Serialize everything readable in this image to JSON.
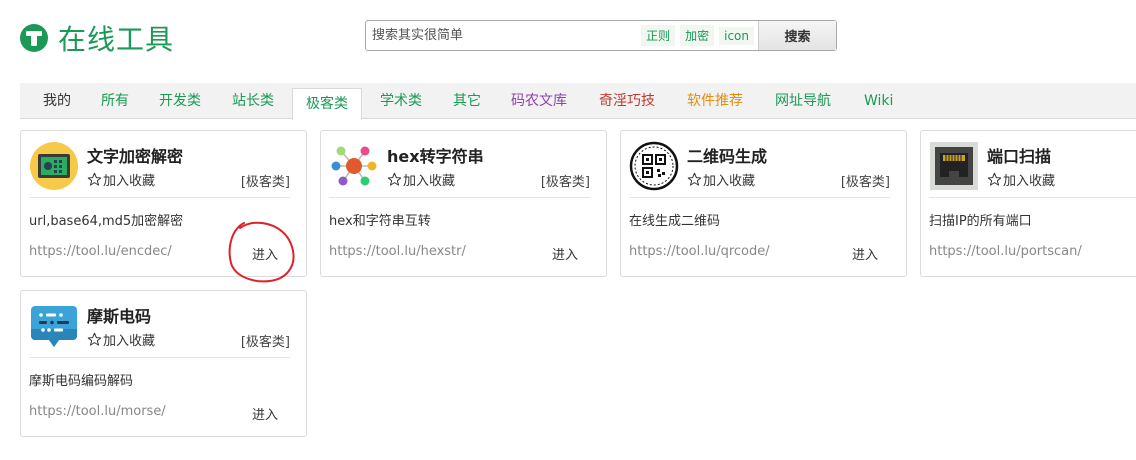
{
  "header": {
    "logo_text": "在线工具",
    "search_placeholder": "搜索其实很简单",
    "search_tags": [
      "正则",
      "加密",
      "icon"
    ],
    "search_button": "搜索"
  },
  "tabs": [
    {
      "label": "我的",
      "color": "#333333"
    },
    {
      "label": "所有",
      "color": "#1a9a55"
    },
    {
      "label": "开发类",
      "color": "#1a9a55"
    },
    {
      "label": "站长类",
      "color": "#1a9a55"
    },
    {
      "label": "极客类",
      "color": "#1a9a55",
      "active": true
    },
    {
      "label": "学术类",
      "color": "#1a9a55"
    },
    {
      "label": "其它",
      "color": "#1a9a55"
    },
    {
      "label": "码农文库",
      "color": "#8e44ad"
    },
    {
      "label": "奇淫巧技",
      "color": "#c0392b"
    },
    {
      "label": "软件推荐",
      "color": "#e08e0b"
    },
    {
      "label": "网址导航",
      "color": "#1a9a55"
    },
    {
      "label": "Wiki",
      "color": "#1a9a55"
    }
  ],
  "cards": [
    {
      "title": "文字加密解密",
      "fav": "加入收藏",
      "category": "[极客类]",
      "desc": "url,base64,md5加密解密",
      "url": "https://tool.lu/encdec/",
      "enter": "进入",
      "icon": "safe-icon"
    },
    {
      "title": "hex转字符串",
      "fav": "加入收藏",
      "category": "[极客类]",
      "desc": "hex和字符串互转",
      "url": "https://tool.lu/hexstr/",
      "enter": "进入",
      "icon": "network-icon"
    },
    {
      "title": "二维码生成",
      "fav": "加入收藏",
      "category": "[极客类]",
      "desc": "在线生成二维码",
      "url": "https://tool.lu/qrcode/",
      "enter": "进入",
      "icon": "qrcode-icon"
    },
    {
      "title": "端口扫描",
      "fav": "加入收藏",
      "category": "",
      "desc": "扫描IP的所有端口",
      "url": "https://tool.lu/portscan/",
      "enter": "",
      "icon": "ethernet-port-icon"
    },
    {
      "title": "摩斯电码",
      "fav": "加入收藏",
      "category": "[极客类]",
      "desc": "摩斯电码编码解码",
      "url": "https://tool.lu/morse/",
      "enter": "进入",
      "icon": "morse-chat-icon"
    }
  ],
  "colors": {
    "brand": "#1a9a55",
    "annotation": "#e0202a"
  }
}
